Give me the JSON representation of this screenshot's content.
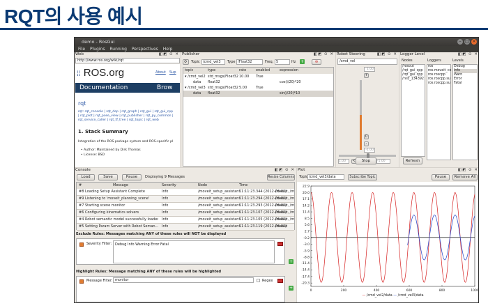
{
  "slide": {
    "title": "RQT의 사용 예시"
  },
  "window": {
    "title": "demo - RosGui",
    "menus": [
      "File",
      "Plugins",
      "Running",
      "Perspectives",
      "Help"
    ]
  },
  "web": {
    "pane_title": "Web",
    "url": "http://www.ros.org/wiki/rqt",
    "logo": "ROS.org",
    "top_links": [
      "About",
      "Sup"
    ],
    "nav": [
      "Documentation",
      "Brow"
    ],
    "heading": "rqt",
    "links_text": [
      "rqt: rqt_console | rqt_dep | rqt_graph | rqt_gui | rqt_gui_cpp",
      "| rqt_plot | rqt_pose_view | rqt_publisher | rqt_py_common |",
      "rqt_service_caller | rqt_tf_tree | rqt_topic | rqt_web"
    ],
    "section": "1. Stack Summary",
    "summary": "Integration of the ROS package system and ROS-specific pl",
    "bullets": [
      "Author: Maintained by Dirk Thomas",
      "License: BSD"
    ]
  },
  "publisher": {
    "pane_title": "Publisher",
    "topic_label": "Topic",
    "topic": "/cmd_vel3",
    "type_label": "Type",
    "type": "/Float32",
    "freq_label": "Freq.",
    "freq": "5",
    "hz": "Hz",
    "columns": [
      "topic",
      "type",
      "rate",
      "enabled",
      "expression"
    ],
    "rows": [
      [
        "▾ /cmd_vel2",
        "std_msgs/Float32",
        "10.00",
        "True",
        ""
      ],
      [
        "data",
        "float32",
        "",
        "",
        "cos(i/20)*20"
      ],
      [
        "▾ /cmd_vel3",
        "std_msgs/Float32",
        "5.00",
        "True",
        ""
      ],
      [
        "data",
        "float32",
        "",
        "",
        "sin(i/20)*10"
      ]
    ]
  },
  "steering": {
    "pane_title": "Robot Steering",
    "topic": "/cmd_vel",
    "top_value": "1.00",
    "bottom_value": "-1.00",
    "left_value": "1.00",
    "right_value": "-1.00",
    "stop": "Stop",
    "small_buttons": [
      "+",
      "0",
      "-",
      "<",
      ">"
    ],
    "center": "0"
  },
  "logger": {
    "pane_title": "Logger Level",
    "nodes_label": "Nodes",
    "loggers_label": "Loggers",
    "levels_label": "Levels",
    "nodes": [
      "/rosout",
      "/rqt_gui_cpp",
      "/rqt_gui_cpp",
      "/rviz_134392"
    ],
    "loggers": [
      "ros",
      "ros.moveit_co",
      "ros.roscpp",
      "ros.roscpp.su",
      "ros.roscpp.su"
    ],
    "levels": [
      "Debug",
      "Info",
      "Warn",
      "Error",
      "Fatal"
    ],
    "selected_level": "Info",
    "refresh": "Refresh"
  },
  "console": {
    "pane_title": "Console",
    "load": "Load",
    "save": "Save",
    "pause": "Pause",
    "status": "Displaying 9 Messages",
    "resize": "Resize Columns",
    "columns": [
      "#",
      "Message",
      "Severity",
      "Node",
      "Time"
    ],
    "rows": [
      [
        "#8",
        "Loading Setup Assistant Complete",
        "Info",
        "/moveit_setup_assistant",
        "11:11:23.344 (2012-06-02)",
        "/rosout, /move"
      ],
      [
        "#9",
        "Listening to 'moveit_planning_scene'",
        "Info",
        "/moveit_setup_assistant",
        "11:11:23.294 (2012-06-02)",
        "/rosout, /move"
      ],
      [
        "#7",
        "Starting scene monitor",
        "Info",
        "/moveit_setup_assistant",
        "11:11:23.293 (2012-06-02)",
        "/rosout, /move"
      ],
      [
        "#6",
        "Configuring kinematics solvers",
        "Info",
        "/moveit_setup_assistant",
        "11:11:23.107 (2012-06-02)",
        "/rosout, /move"
      ],
      [
        "#4",
        "Robot semantic model successfully loaded.",
        "Info",
        "/moveit_setup_assistant",
        "11:11:23.105 (2012-06-02)",
        "/rosout, /move"
      ],
      [
        "#5",
        "Setting Param Server with Robot Seman...",
        "Info",
        "/moveit_setup_assistant",
        "11:11:23.119 (2012-06-02)",
        "/rosout"
      ]
    ],
    "exclude_title": "Exclude Rules: Messages matching ANY of these rules will NOT be displayed",
    "severity_label": "Severity Filter:",
    "severities": [
      "Debug",
      "Info",
      "Warning",
      "Error",
      "Fatal"
    ],
    "highlight_title": "Highlight Rules: Message matching ANY of these rules will be highlighted",
    "message_label": "Message Filter:",
    "message_value": "monitor",
    "regex": "Regex"
  },
  "plot": {
    "pane_title": "Plot",
    "topic_label": "Topic",
    "topic": "/cmd_vel3/data",
    "subscribe": "Subscribe Topic",
    "pause": "Pause",
    "remove": "Remove All",
    "legend": [
      "/cmd_vel2/data",
      "/cmd_vel3/data"
    ],
    "chart_data": {
      "type": "line",
      "xlim": [
        0,
        1000
      ],
      "ylim": [
        -21.8,
        22.9
      ],
      "x_ticks": [
        0,
        200,
        400,
        600,
        800,
        1000
      ],
      "y_ticks": [
        22.9,
        20.0,
        17.1,
        14.2,
        11.4,
        8.5,
        5.6,
        2.7,
        -0.2,
        -3.0,
        -5.9,
        -8.8,
        -11.4,
        -14.4,
        -17.4,
        -20.3
      ],
      "series": [
        {
          "name": "/cmd_vel2/data",
          "color": "#d62020",
          "amplitude": 20,
          "period": 125.7,
          "x_range": [
            0,
            1000
          ]
        },
        {
          "name": "/cmd_vel3/data",
          "color": "#2040c8",
          "amplitude": 10,
          "period": 125.7,
          "x_range": [
            590,
            1000
          ]
        }
      ]
    }
  },
  "colors": {
    "title": "#0b3a73",
    "red": "#d62020",
    "blue": "#2040c8"
  }
}
